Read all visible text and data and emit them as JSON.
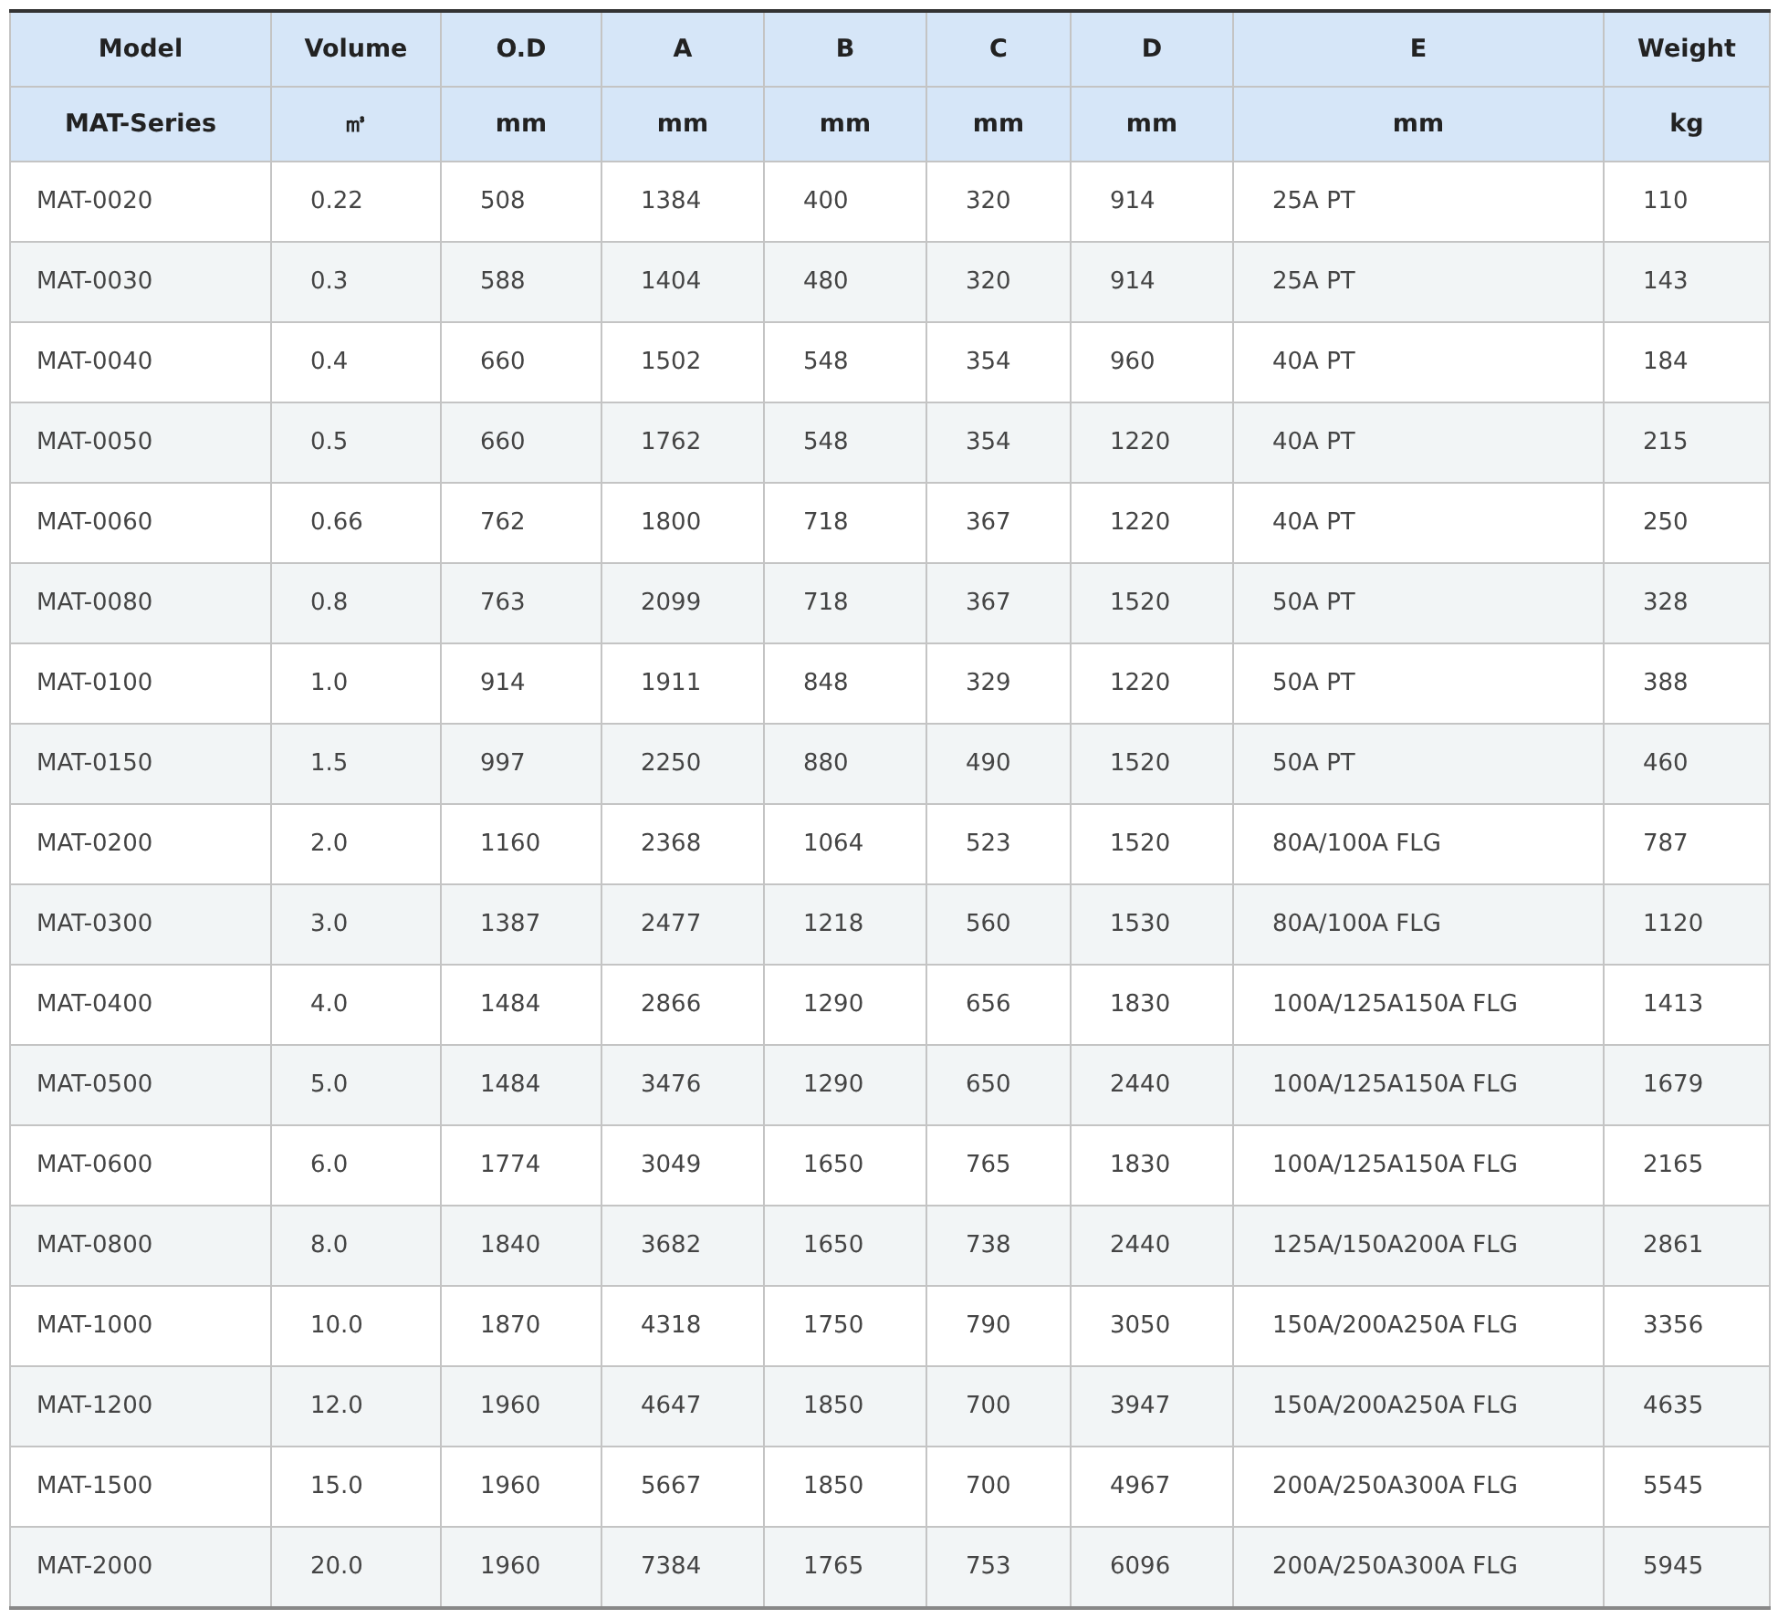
{
  "table": {
    "columns": [
      {
        "header": "Model",
        "unit": "MAT-Series"
      },
      {
        "header": "Volume",
        "unit": "㎥"
      },
      {
        "header": "O.D",
        "unit": "mm"
      },
      {
        "header": "A",
        "unit": "mm"
      },
      {
        "header": "B",
        "unit": "mm"
      },
      {
        "header": "C",
        "unit": "mm"
      },
      {
        "header": "D",
        "unit": "mm"
      },
      {
        "header": "E",
        "unit": "mm"
      },
      {
        "header": "Weight",
        "unit": "kg"
      }
    ],
    "rows": [
      [
        "MAT-0020",
        "0.22",
        "508",
        "1384",
        "400",
        "320",
        "914",
        "25A PT",
        "110"
      ],
      [
        "MAT-0030",
        "0.3",
        "588",
        "1404",
        "480",
        "320",
        "914",
        "25A PT",
        "143"
      ],
      [
        "MAT-0040",
        "0.4",
        "660",
        "1502",
        "548",
        "354",
        "960",
        "40A PT",
        "184"
      ],
      [
        "MAT-0050",
        "0.5",
        "660",
        "1762",
        "548",
        "354",
        "1220",
        "40A PT",
        "215"
      ],
      [
        "MAT-0060",
        "0.66",
        "762",
        "1800",
        "718",
        "367",
        "1220",
        "40A PT",
        "250"
      ],
      [
        "MAT-0080",
        "0.8",
        "763",
        "2099",
        "718",
        "367",
        "1520",
        "50A PT",
        "328"
      ],
      [
        "MAT-0100",
        "1.0",
        "914",
        "1911",
        "848",
        "329",
        "1220",
        "50A PT",
        "388"
      ],
      [
        "MAT-0150",
        "1.5",
        "997",
        "2250",
        "880",
        "490",
        "1520",
        "50A PT",
        "460"
      ],
      [
        "MAT-0200",
        "2.0",
        "1160",
        "2368",
        "1064",
        "523",
        "1520",
        "80A/100A FLG",
        "787"
      ],
      [
        "MAT-0300",
        "3.0",
        "1387",
        "2477",
        "1218",
        "560",
        "1530",
        "80A/100A FLG",
        "1120"
      ],
      [
        "MAT-0400",
        "4.0",
        "1484",
        "2866",
        "1290",
        "656",
        "1830",
        "100A/125A150A FLG",
        "1413"
      ],
      [
        "MAT-0500",
        "5.0",
        "1484",
        "3476",
        "1290",
        "650",
        "2440",
        "100A/125A150A FLG",
        "1679"
      ],
      [
        "MAT-0600",
        "6.0",
        "1774",
        "3049",
        "1650",
        "765",
        "1830",
        "100A/125A150A FLG",
        "2165"
      ],
      [
        "MAT-0800",
        "8.0",
        "1840",
        "3682",
        "1650",
        "738",
        "2440",
        "125A/150A200A FLG",
        "2861"
      ],
      [
        "MAT-1000",
        "10.0",
        "1870",
        "4318",
        "1750",
        "790",
        "3050",
        "150A/200A250A FLG",
        "3356"
      ],
      [
        "MAT-1200",
        "12.0",
        "1960",
        "4647",
        "1850",
        "700",
        "3947",
        "150A/200A250A FLG",
        "4635"
      ],
      [
        "MAT-1500",
        "15.0",
        "1960",
        "5667",
        "1850",
        "700",
        "4967",
        "200A/250A300A FLG",
        "5545"
      ],
      [
        "MAT-2000",
        "20.0",
        "1960",
        "7384",
        "1765",
        "753",
        "6096",
        "200A/250A300A FLG",
        "5945"
      ]
    ]
  }
}
